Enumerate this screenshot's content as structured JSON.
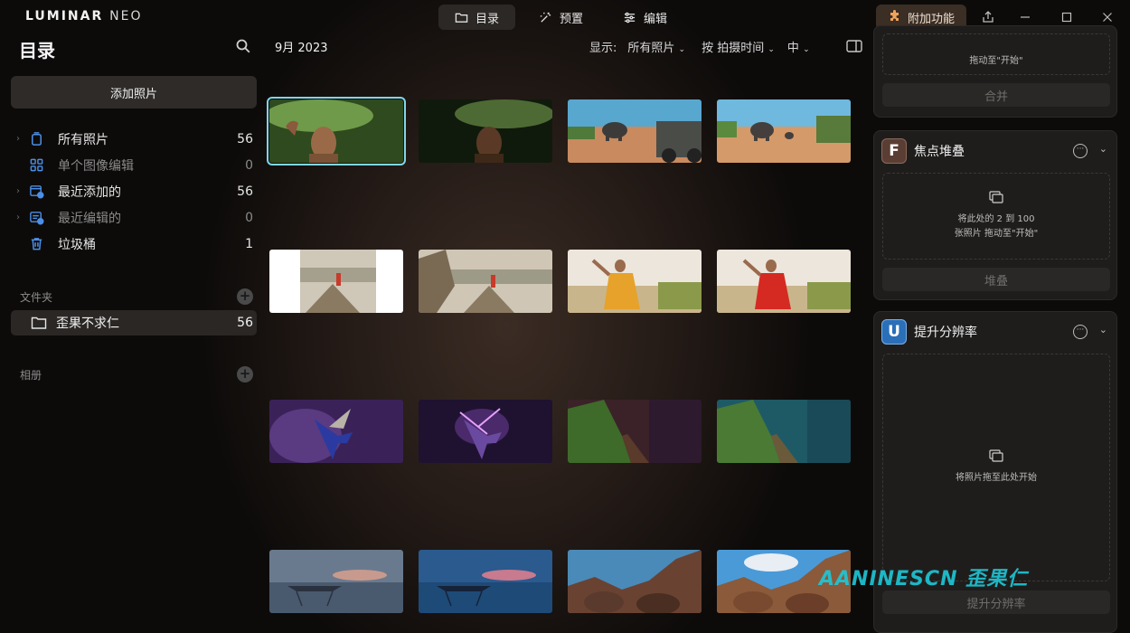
{
  "app": {
    "logo_main": "LUMINAR",
    "logo_suffix": "NEO"
  },
  "modes": [
    {
      "label": "目录",
      "icon": "folder-icon",
      "active": true
    },
    {
      "label": "预置",
      "icon": "magic-wand-icon",
      "active": false
    },
    {
      "label": "编辑",
      "icon": "sliders-icon",
      "active": false
    }
  ],
  "addon": {
    "label": "附加功能",
    "icon": "puzzle-icon"
  },
  "sidebar": {
    "title": "目录",
    "add_photos": "添加照片",
    "items": [
      {
        "label": "所有照片",
        "count": "56",
        "icon": "photos-icon",
        "expandable": true,
        "dim": false
      },
      {
        "label": "单个图像编辑",
        "count": "0",
        "icon": "grid-icon",
        "expandable": false,
        "dim": true
      },
      {
        "label": "最近添加的",
        "count": "56",
        "icon": "recent-added-icon",
        "expandable": true,
        "dim": false
      },
      {
        "label": "最近编辑的",
        "count": "0",
        "icon": "recent-edited-icon",
        "expandable": true,
        "dim": true
      },
      {
        "label": "垃圾桶",
        "count": "1",
        "icon": "trash-icon",
        "expandable": false,
        "dim": false
      }
    ],
    "folders_header": "文件夹",
    "folder": {
      "label": "歪果不求仁",
      "count": "56"
    },
    "albums_header": "相册"
  },
  "gallery": {
    "date": "9月 2023",
    "filter_show_label": "显示:",
    "filter_show_value": "所有照片",
    "filter_sort": "按 拍摄时间",
    "filter_size": "中"
  },
  "right_panel": {
    "merge": {
      "drop_tail": "拖动至\"开始\"",
      "button": "合并"
    },
    "focus_stack": {
      "title": "焦点堆叠",
      "badge": "F",
      "badge_color": "#5a3d33",
      "drop_line1": "将此处的 2 到 100",
      "drop_line2": "张照片 拖动至\"开始\"",
      "button": "堆叠"
    },
    "upscale": {
      "title": "提升分辨率",
      "badge": "U",
      "badge_color": "#2a6fb8",
      "drop_text": "将照片拖至此处开始",
      "button": "提升分辨率"
    }
  },
  "watermark": "AANINESCN 歪果仁",
  "colors": {
    "accent_selection": "#7fd6e8",
    "addon_bg": "#3a2e25"
  }
}
